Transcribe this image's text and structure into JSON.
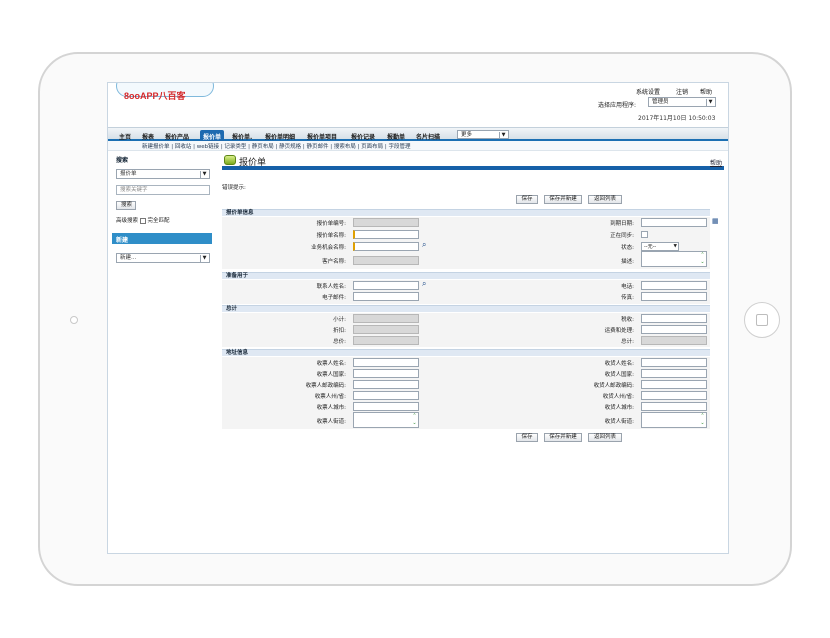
{
  "logo": {
    "text": "8ooAPP八百客"
  },
  "top_menu": {
    "settings": "系统设置",
    "logout": "注销",
    "help": "帮助"
  },
  "app_select": {
    "label": "选择应用程序:",
    "value": "管理员"
  },
  "datetime": "2017年11月10日 10:50:03",
  "tabs": [
    {
      "label": "主页"
    },
    {
      "label": "报表"
    },
    {
      "label": "报价产品"
    },
    {
      "label": "报价单"
    },
    {
      "label": "报价单."
    },
    {
      "label": "报价单明细"
    },
    {
      "label": "报价单项目"
    },
    {
      "label": "报价记录"
    },
    {
      "label": "报勤单"
    },
    {
      "label": "名片扫描"
    }
  ],
  "more_select": "更多",
  "sub_links": "新建报价单 | 回收站 | web链接 | 记录类型 | 静页布局 | 静页规格 | 静页邮件 | 搜索布局 | 页面布局 | 字段管理",
  "sidebar": {
    "search_title": "搜索",
    "search_select": "报价单",
    "search_placeholder": "搜索关键字",
    "search_button": "搜索",
    "advanced": "高级搜索",
    "exact": "完全匹配",
    "new_title": "新建",
    "new_select": "新建..."
  },
  "page": {
    "title": "报价单",
    "help": "帮助",
    "note": "错误提示:"
  },
  "buttons": {
    "save": "保存",
    "save_new": "保存并新建",
    "back": "返回列表"
  },
  "sections": {
    "info": {
      "title": "报价单信息",
      "left": [
        "报价单编号:",
        "报价单名称:",
        "业务机会名称:",
        "客户名称:"
      ],
      "right": [
        "到期日期:",
        "正在同步:",
        "状态:",
        "描述:"
      ],
      "status_value": "--无--"
    },
    "contact": {
      "title": "准备用于",
      "left": [
        "联系人姓名:",
        "电子邮件:"
      ],
      "right": [
        "电话:",
        "传真:"
      ]
    },
    "total": {
      "title": "总计",
      "left": [
        "小计:",
        "折扣:",
        "总价:"
      ],
      "right": [
        "税收:",
        "运费和处理:",
        "总计:"
      ]
    },
    "address": {
      "title": "地址信息",
      "left": [
        "收票人姓名:",
        "收票人国家:",
        "收票人邮政编码:",
        "收票人州/省:",
        "收票人城市:",
        "收票人街道:"
      ],
      "right": [
        "收货人姓名:",
        "收货人国家:",
        "收货人邮政编码:",
        "收货人州/省:",
        "收货人城市:",
        "收货人街道:"
      ]
    }
  }
}
